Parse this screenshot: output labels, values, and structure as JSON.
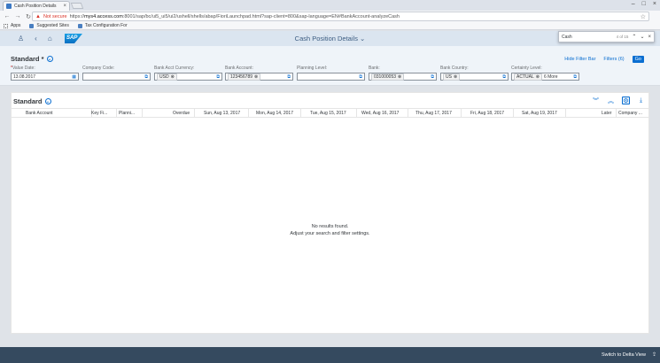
{
  "browser": {
    "tab_title": "Cash Position Details",
    "not_secure": "Not secure",
    "url_prefix": "https://",
    "url_domain": "mys4.access.com",
    "url_rest": ":8001/sap/bc/ui5_ui5/ui2/ushell/shells/abap/FioriLaunchpad.html?sap-client=800&sap-language=EN#BankAccount-analyzeCash",
    "bookmarks": [
      "Apps",
      "Suggested Sites",
      "Tax Configuration For"
    ]
  },
  "findbar": {
    "query": "Cash",
    "count": "4 of 15"
  },
  "shell": {
    "title": "Cash Position Details"
  },
  "filters": {
    "variant": "Standard *",
    "hide_filter_bar": "Hide Filter Bar",
    "filters_label": "Filters (6)",
    "go": "Go",
    "fields": [
      {
        "label": "Value Date:",
        "value": "13.08.2017"
      },
      {
        "label": "Company Code:",
        "value": ""
      },
      {
        "label": "Bank Acct Currency:",
        "value": "USD"
      },
      {
        "label": "Bank Account:",
        "value": "123456789"
      },
      {
        "label": "Planning Level:",
        "value": ""
      },
      {
        "label": "Bank:",
        "value": "031000053"
      },
      {
        "label": "Bank Country:",
        "value": "US"
      },
      {
        "label": "Certainty Level:",
        "value": "ACTUAL",
        "more": "6 More"
      }
    ]
  },
  "table": {
    "title": "Standard",
    "columns": [
      "Bank Account",
      "Key Fi...",
      "Planni...",
      "Overdue",
      "Sun, Aug 13, 2017",
      "Mon, Aug 14, 2017",
      "Tue, Aug 15, 2017",
      "Wed, Aug 16, 2017",
      "Thu, Aug 17, 2017",
      "Fri, Aug 18, 2017",
      "Sat, Aug 19, 2017",
      "Later",
      "Company ..."
    ],
    "no_data_line1": "No results found.",
    "no_data_line2": "Adjust your search and filter settings."
  },
  "footer": {
    "delta_view": "Switch to Delta View"
  },
  "colors": {
    "shell_bg": "#dbe5f0",
    "accent": "#0a6ed1",
    "footer_bg": "#354a5f",
    "not_secure": "#d93025"
  }
}
